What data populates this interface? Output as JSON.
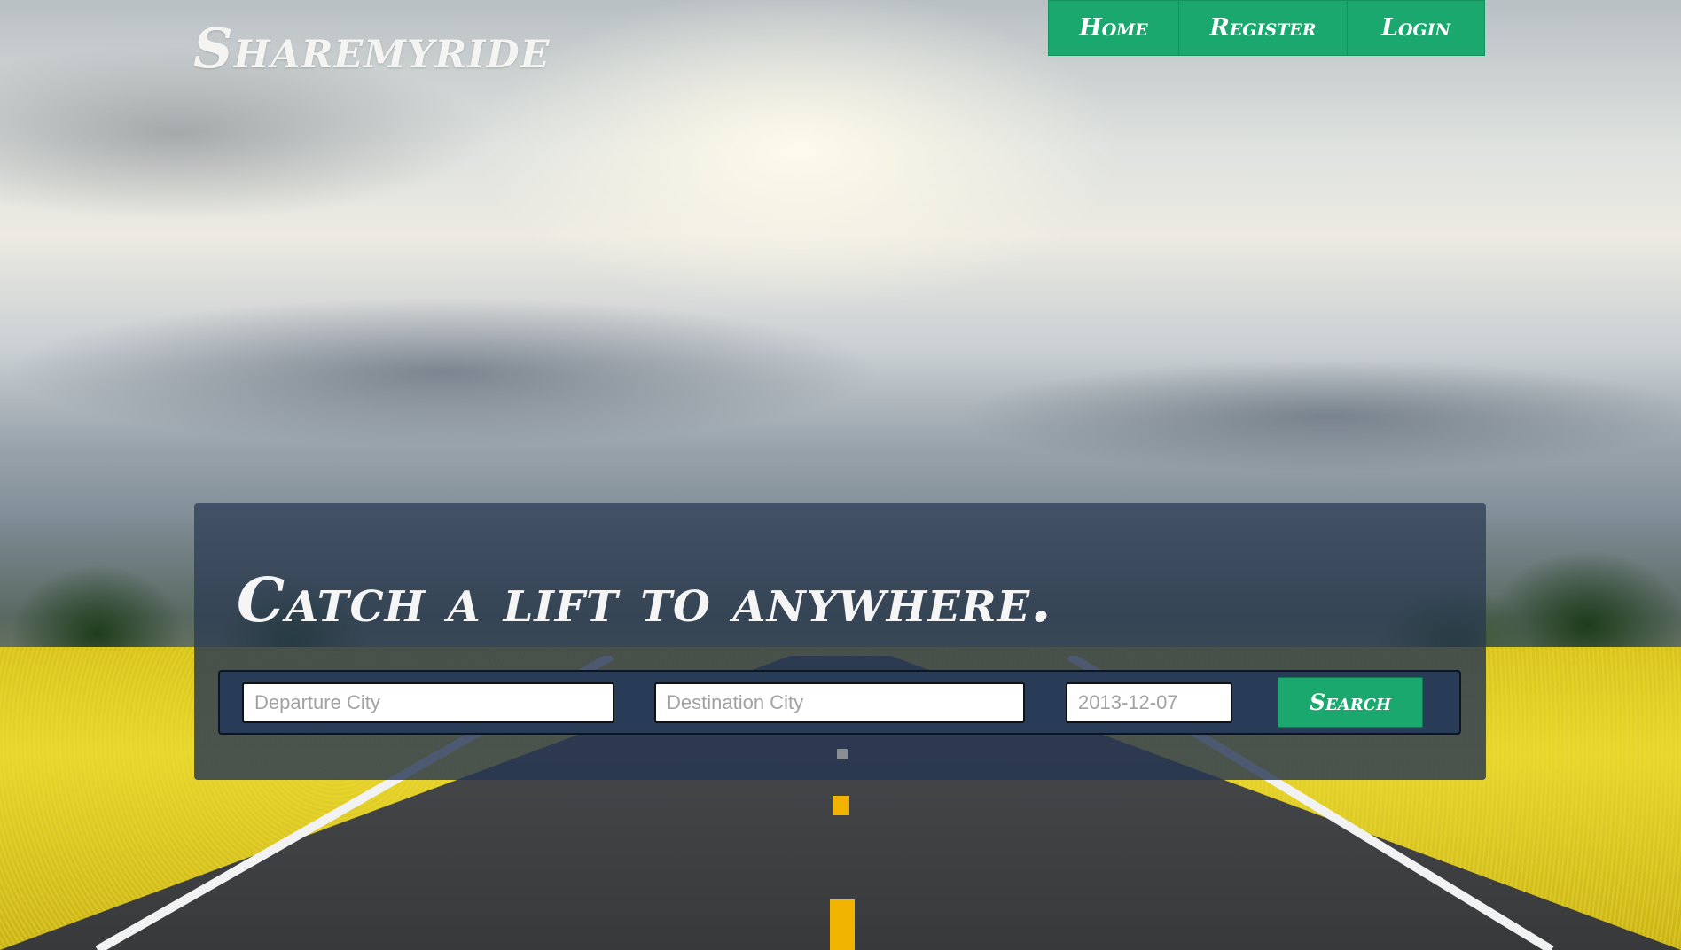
{
  "brand": {
    "name": "Sharemyride"
  },
  "nav": {
    "items": [
      {
        "label": "Home"
      },
      {
        "label": "Register"
      },
      {
        "label": "Login"
      }
    ]
  },
  "hero": {
    "headline": "Catch a lift to anywhere."
  },
  "search": {
    "departure_placeholder": "Departure City",
    "destination_placeholder": "Destination City",
    "date_placeholder": "2013-12-07",
    "button_label": "Search"
  },
  "colors": {
    "accent": "#1aa86e",
    "panel": "#283b57",
    "text_light": "#f5f5f5"
  }
}
